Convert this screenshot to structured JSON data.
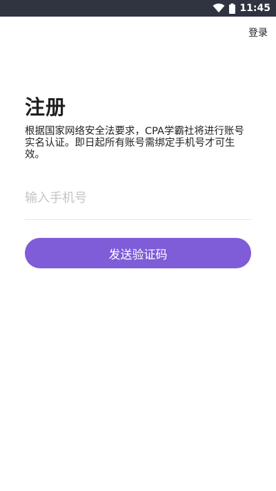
{
  "status_bar": {
    "time": "11:45",
    "icons": [
      "wifi-icon",
      "battery-icon"
    ]
  },
  "header": {
    "login_label": "登录"
  },
  "main": {
    "title": "注册",
    "notice": "根据国家网络安全法要求，CPA学霸社将进行账号实名认证。即日起所有账号需绑定手机号才可生效。",
    "phone_placeholder": "输入手机号",
    "phone_value": "",
    "send_code_label": "发送验证码"
  },
  "colors": {
    "status_bar_bg": "#2f3440",
    "accent": "#7f5cd8",
    "placeholder": "#c4c4c4",
    "divider": "#e6e6e6"
  }
}
